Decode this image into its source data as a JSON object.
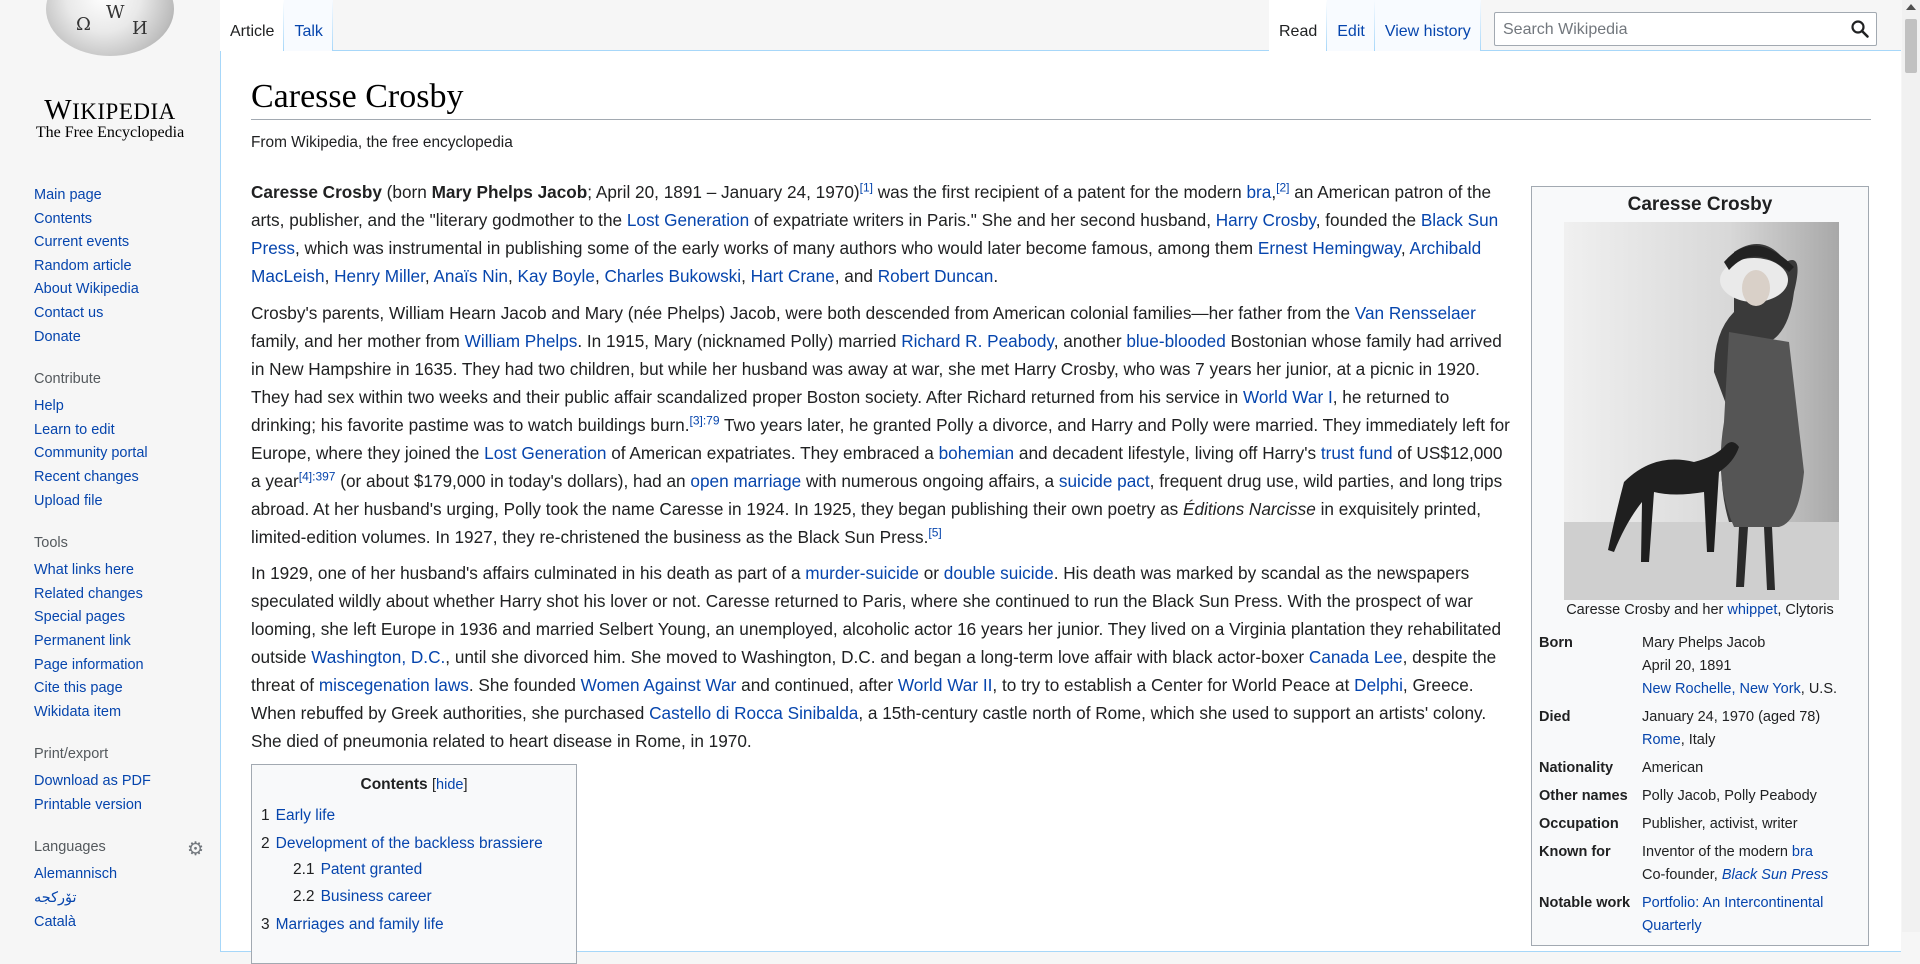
{
  "logo": {
    "wordmark": "Wikipedia",
    "tagline": "The Free Encyclopedia",
    "glyphs": [
      "Ω",
      "W",
      "И"
    ]
  },
  "sidebar": {
    "nav": [
      "Main page",
      "Contents",
      "Current events",
      "Random article",
      "About Wikipedia",
      "Contact us",
      "Donate"
    ],
    "contribute": {
      "heading": "Contribute",
      "items": [
        "Help",
        "Learn to edit",
        "Community portal",
        "Recent changes",
        "Upload file"
      ]
    },
    "tools": {
      "heading": "Tools",
      "items": [
        "What links here",
        "Related changes",
        "Special pages",
        "Permanent link",
        "Page information",
        "Cite this page",
        "Wikidata item"
      ]
    },
    "print": {
      "heading": "Print/export",
      "items": [
        "Download as PDF",
        "Printable version"
      ]
    },
    "languages": {
      "heading": "Languages",
      "items": [
        "Alemannisch",
        "تۆرکجه",
        "Català"
      ]
    }
  },
  "tabs": {
    "article": "Article",
    "talk": "Talk",
    "read": "Read",
    "edit": "Edit",
    "history": "View history"
  },
  "search": {
    "placeholder": "Search Wikipedia"
  },
  "article": {
    "title": "Caresse Crosby",
    "from": "From Wikipedia, the free encyclopedia",
    "p1": [
      [
        "b",
        "Caresse Crosby"
      ],
      [
        "t",
        " (born "
      ],
      [
        "b",
        "Mary Phelps Jacob"
      ],
      [
        "t",
        "; April 20, 1891 – January 24, 1970)"
      ],
      [
        "s",
        "[1]"
      ],
      [
        "t",
        " was the first recipient of a patent for the modern "
      ],
      [
        "a",
        "bra"
      ],
      [
        "t",
        ","
      ],
      [
        "s",
        "[2]"
      ],
      [
        "t",
        " an American patron of the arts, publisher, and the \"literary godmother to the "
      ],
      [
        "a",
        "Lost Generation"
      ],
      [
        "t",
        " of expatriate writers in Paris.\" She and her second husband, "
      ],
      [
        "a",
        "Harry Crosby"
      ],
      [
        "t",
        ", founded the "
      ],
      [
        "a",
        "Black Sun Press"
      ],
      [
        "t",
        ", which was instrumental in publishing some of the early works of many authors who would later become famous, among them "
      ],
      [
        "a",
        "Ernest Hemingway"
      ],
      [
        "t",
        ", "
      ],
      [
        "a",
        "Archibald MacLeish"
      ],
      [
        "t",
        ", "
      ],
      [
        "a",
        "Henry Miller"
      ],
      [
        "t",
        ", "
      ],
      [
        "a",
        "Anaïs Nin"
      ],
      [
        "t",
        ", "
      ],
      [
        "a",
        "Kay Boyle"
      ],
      [
        "t",
        ", "
      ],
      [
        "a",
        "Charles Bukowski"
      ],
      [
        "t",
        ", "
      ],
      [
        "a",
        "Hart Crane"
      ],
      [
        "t",
        ", and "
      ],
      [
        "a",
        "Robert Duncan"
      ],
      [
        "t",
        "."
      ]
    ],
    "p2": [
      [
        "t",
        "Crosby's parents, William Hearn Jacob and Mary (née Phelps) Jacob, were both descended from American colonial families—her father from the "
      ],
      [
        "a",
        "Van Rensselaer"
      ],
      [
        "t",
        " family, and her mother from "
      ],
      [
        "a",
        "William Phelps"
      ],
      [
        "t",
        ". In 1915, Mary (nicknamed Polly) married "
      ],
      [
        "a",
        "Richard R. Peabody"
      ],
      [
        "t",
        ", another "
      ],
      [
        "a",
        "blue-blooded"
      ],
      [
        "t",
        " Bostonian whose family had arrived in New Hampshire in 1635. They had two children, but while her husband was away at war, she met Harry Crosby, who was 7 years her junior, at a picnic in 1920. They had sex within two weeks and their public affair scandalized proper Boston society. After Richard returned from his service in "
      ],
      [
        "a",
        "World War I"
      ],
      [
        "t",
        ", he returned to drinking; his favorite pastime was to watch buildings burn."
      ],
      [
        "s",
        "[3]:79"
      ],
      [
        "t",
        " Two years later, he granted Polly a divorce, and Harry and Polly were married. They immediately left for Europe, where they joined the "
      ],
      [
        "a",
        "Lost Generation"
      ],
      [
        "t",
        " of American expatriates. They embraced a "
      ],
      [
        "a",
        "bohemian"
      ],
      [
        "t",
        " and decadent lifestyle, living off Harry's "
      ],
      [
        "a",
        "trust fund"
      ],
      [
        "t",
        " of US$12,000 a year"
      ],
      [
        "s",
        "[4]:397"
      ],
      [
        "t",
        " (or about $179,000 in today's dollars), had an "
      ],
      [
        "a",
        "open marriage"
      ],
      [
        "t",
        " with numerous ongoing affairs, a "
      ],
      [
        "a",
        "suicide pact"
      ],
      [
        "t",
        ", frequent drug use, wild parties, and long trips abroad. At her husband's urging, Polly took the name Caresse in 1924. In 1925, they began publishing their own poetry as "
      ],
      [
        "i",
        "Éditions Narcisse"
      ],
      [
        "t",
        " in exquisitely printed, limited-edition volumes. In 1927, they re-christened the business as the Black Sun Press."
      ],
      [
        "s",
        "[5]"
      ]
    ],
    "p3": [
      [
        "t",
        "In 1929, one of her husband's affairs culminated in his death as part of a "
      ],
      [
        "a",
        "murder-suicide"
      ],
      [
        "t",
        " or "
      ],
      [
        "a",
        "double suicide"
      ],
      [
        "t",
        ". His death was marked by scandal as the newspapers speculated wildly about whether Harry shot his lover or not. Caresse returned to Paris, where she continued to run the Black Sun Press. With the prospect of war looming, she left Europe in 1936 and married Selbert Young, an unemployed, alcoholic actor 16 years her junior. They lived on a Virginia plantation they rehabilitated outside "
      ],
      [
        "a",
        "Washington, D.C."
      ],
      [
        "t",
        ", until she divorced him. She moved to Washington, D.C. and began a long-term love affair with black actor-boxer "
      ],
      [
        "a",
        "Canada Lee"
      ],
      [
        "t",
        ", despite the threat of "
      ],
      [
        "a",
        "miscegenation laws"
      ],
      [
        "t",
        ". She founded "
      ],
      [
        "a",
        "Women Against War"
      ],
      [
        "t",
        " and continued, after "
      ],
      [
        "a",
        "World War II"
      ],
      [
        "t",
        ", to try to establish a Center for World Peace at "
      ],
      [
        "a",
        "Delphi"
      ],
      [
        "t",
        ", Greece. When rebuffed by Greek authorities, she purchased "
      ],
      [
        "a",
        "Castello di Rocca Sinibalda"
      ],
      [
        "t",
        ", a 15th-century castle north of Rome, which she used to support an artists' colony. She died of pneumonia related to heart disease in Rome, in 1970."
      ]
    ]
  },
  "toc": {
    "heading": "Contents",
    "hide": "hide",
    "items": [
      {
        "num": "1",
        "label": "Early life"
      },
      {
        "num": "2",
        "label": "Development of the backless brassiere"
      },
      {
        "num": "2.1",
        "label": "Patent granted"
      },
      {
        "num": "2.2",
        "label": "Business career"
      },
      {
        "num": "3",
        "label": "Marriages and family life"
      }
    ]
  },
  "infobox": {
    "title": "Caresse Crosby",
    "caption_pre": "Caresse Crosby and her ",
    "caption_link": "whippet",
    "caption_post": ", Clytoris",
    "born_label": "Born",
    "born_name": "Mary Phelps Jacob",
    "born_date": "April 20, 1891",
    "born_place_link": "New Rochelle, New York",
    "born_place_rest": ", U.S.",
    "died_label": "Died",
    "died_date": "January 24, 1970 (aged 78)",
    "died_place_link": "Rome",
    "died_place_rest": ", Italy",
    "nationality_label": "Nationality",
    "nationality": "American",
    "other_label": "Other names",
    "other": "Polly Jacob, Polly Peabody",
    "occupation_label": "Occupation",
    "occupation": "Publisher, activist, writer",
    "known_label": "Known for",
    "known_pre": "Inventor of the modern ",
    "known_link": "bra",
    "known_co": "Co-founder, ",
    "known_co_link": "Black Sun Press",
    "notable_label": "Notable work",
    "notable": "Portfolio: An Intercontinental Quarterly"
  },
  "colors": {
    "link": "#0645ad",
    "border": "#a2a9b1",
    "tab_border": "#a7d7f9",
    "sidebar_bg": "#f6f6f6"
  }
}
